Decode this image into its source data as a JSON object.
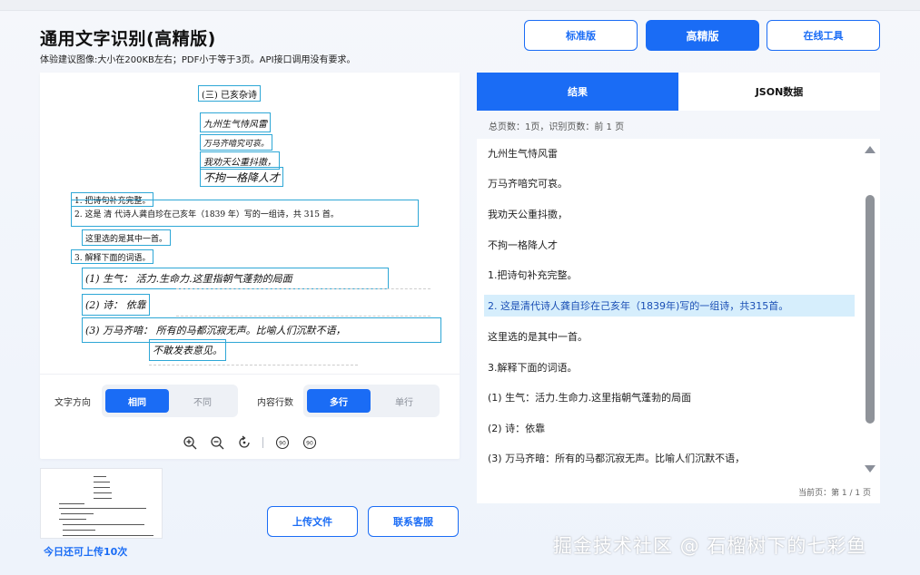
{
  "header": {
    "title": "通用文字识别(高精版)",
    "subtitle": "体验建议图像:大小在200KB左右；PDF小于等于3页。API接口调用没有要求。"
  },
  "versions": [
    {
      "label": "标准版",
      "active": false
    },
    {
      "label": "高精版",
      "active": true
    },
    {
      "label": "在线工具",
      "active": false
    }
  ],
  "document": {
    "lines": [
      "(三)  已亥杂诗",
      "九州生气恃风雷",
      "万马齐喑究可哀。",
      "我劝天公重抖擞，",
      "不拘一格降人才",
      "1. 把诗句补充完整。",
      "2. 这是 清 代诗人龚自珍在己亥年（1839 年）写的一组诗，共 315 首。",
      "这里选的是其中一首。",
      "3. 解释下面的词语。",
      "(1) 生气： 活力.生命力.这里指朝气蓬勃的局面",
      "(2) 诗： 依靠",
      "(3) 万马齐喑： 所有的马都沉寂无声。比喻人们沉默不语，",
      "不敢发表意见。"
    ]
  },
  "controls": {
    "text_direction": {
      "label": "文字方向",
      "options": [
        "相同",
        "不同"
      ],
      "selected": "相同"
    },
    "line_mode": {
      "label": "内容行数",
      "options": [
        "多行",
        "单行"
      ],
      "selected": "多行"
    }
  },
  "toolbar": {
    "icons": [
      "zoom-in-icon",
      "zoom-out-icon",
      "rotate-icon",
      "rotate-left-90-icon",
      "rotate-right-90-icon"
    ],
    "rot_left": "90",
    "rot_right": "90"
  },
  "upload": {
    "quota_text": "今日还可上传10次",
    "upload_label": "上传文件",
    "contact_label": "联系客服"
  },
  "result_panel": {
    "tabs": [
      {
        "label": "结果",
        "active": true
      },
      {
        "label": "JSON数据",
        "active": false
      }
    ],
    "stats": "总页数：1页，识别页数：前 1 页",
    "lines": [
      "九州生气恃风雷",
      "万马齐喑究可哀。",
      "我劝天公重抖擞，",
      "不拘一格降人才",
      "1.把诗句补充完整。",
      "2. 这是清代诗人龚自珍在己亥年（1839年)写的一组诗，共315首。",
      "这里选的是其中一首。",
      "3.解释下面的词语。",
      "(1) 生气：活力.生命力.这里指朝气蓬勃的局面",
      "(2) 诗：依靠",
      "(3) 万马齐暗：所有的马都沉寂无声。比喻人们沉默不语，"
    ],
    "highlighted_index": 5,
    "pager": "当前页：第 1 / 1 页"
  },
  "watermark": "掘金技术社区 @ 石榴树下的七彩鱼",
  "colors": {
    "accent": "#1a6cf5",
    "highlight": "#d6eefc",
    "ocr_box": "#2ea7d6"
  }
}
